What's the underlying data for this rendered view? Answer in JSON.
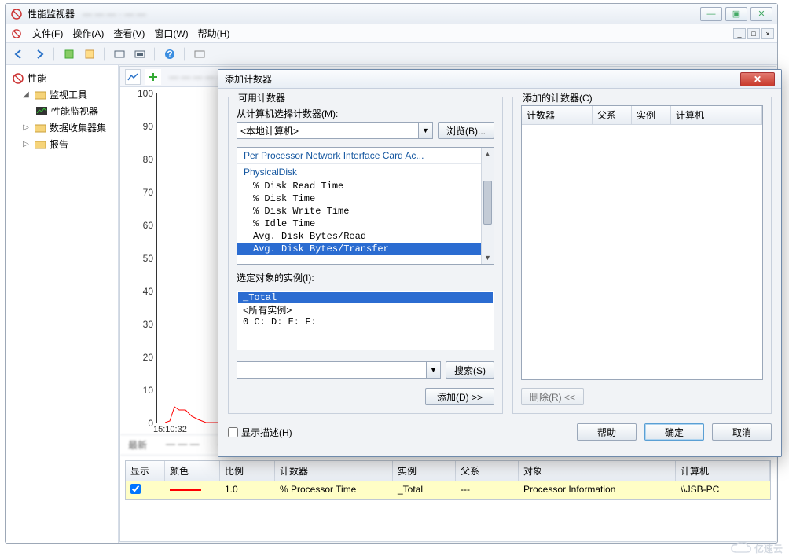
{
  "outer": {
    "title": "性能监视器"
  },
  "window_buttons": {
    "min": "—",
    "max": "▣",
    "close": "✕"
  },
  "menus": {
    "file": "文件(F)",
    "action": "操作(A)",
    "view": "查看(V)",
    "window": "窗口(W)",
    "help": "帮助(H)"
  },
  "tree": {
    "root": "性能",
    "tools": "监视工具",
    "perfmon": "性能监视器",
    "collectors": "数据收集器集",
    "reports": "报告"
  },
  "chart_data": {
    "type": "line",
    "title": "",
    "xlabel": "",
    "ylabel": "",
    "ylim": [
      0,
      100
    ],
    "yticks": [
      0,
      10,
      20,
      30,
      40,
      50,
      60,
      70,
      80,
      90,
      100
    ],
    "time_start": "15:10:32",
    "series": [
      {
        "name": "% Processor Time",
        "color": "#FF0000",
        "x_seconds": [
          0,
          3,
          6,
          9,
          12,
          15,
          18,
          21,
          24
        ],
        "values": [
          0,
          1,
          5,
          4,
          4,
          2,
          1,
          0,
          0
        ]
      }
    ]
  },
  "summary_row": {
    "label": "最新"
  },
  "legend": {
    "headers": {
      "show": "显示",
      "color": "颜色",
      "scale": "比例",
      "counter": "计数器",
      "instance": "实例",
      "parent": "父系",
      "object": "对象",
      "computer": "计算机"
    },
    "row": {
      "show": true,
      "color": "#FF0000",
      "scale": "1.0",
      "counter": "% Processor Time",
      "instance": "_Total",
      "parent": "---",
      "object": "Processor Information",
      "computer": "\\\\JSB-PC"
    }
  },
  "dialog": {
    "title": "添加计数器",
    "available_group": "可用计数器",
    "added_group": "添加的计数器(C)",
    "from_label": "从计算机选择计数器(M):",
    "from_value": "<本地计算机>",
    "browse_btn": "浏览(B)...",
    "categories": {
      "collapsed": "Per Processor Network Interface Card Ac...",
      "expanded": "PhysicalDisk",
      "items": [
        "% Disk Read Time",
        "% Disk Time",
        "% Disk Write Time",
        "% Idle Time",
        "Avg. Disk Bytes/Read",
        "Avg. Disk Bytes/Transfer"
      ],
      "selected_index": 5
    },
    "instances_label": "选定对象的实例(I):",
    "instances": {
      "items": [
        "_Total",
        "<所有实例>",
        "0 C: D: E: F:"
      ],
      "selected_index": 0
    },
    "search_btn": "搜索(S)",
    "add_btn": "添加(D) >>",
    "remove_btn": "删除(R) <<",
    "added_headers": {
      "counter": "计数器",
      "parent": "父系",
      "instance": "实例",
      "computer": "计算机"
    },
    "show_desc": "显示描述(H)",
    "help_btn": "帮助",
    "ok_btn": "确定",
    "cancel_btn": "取消"
  },
  "watermark": "亿速云"
}
